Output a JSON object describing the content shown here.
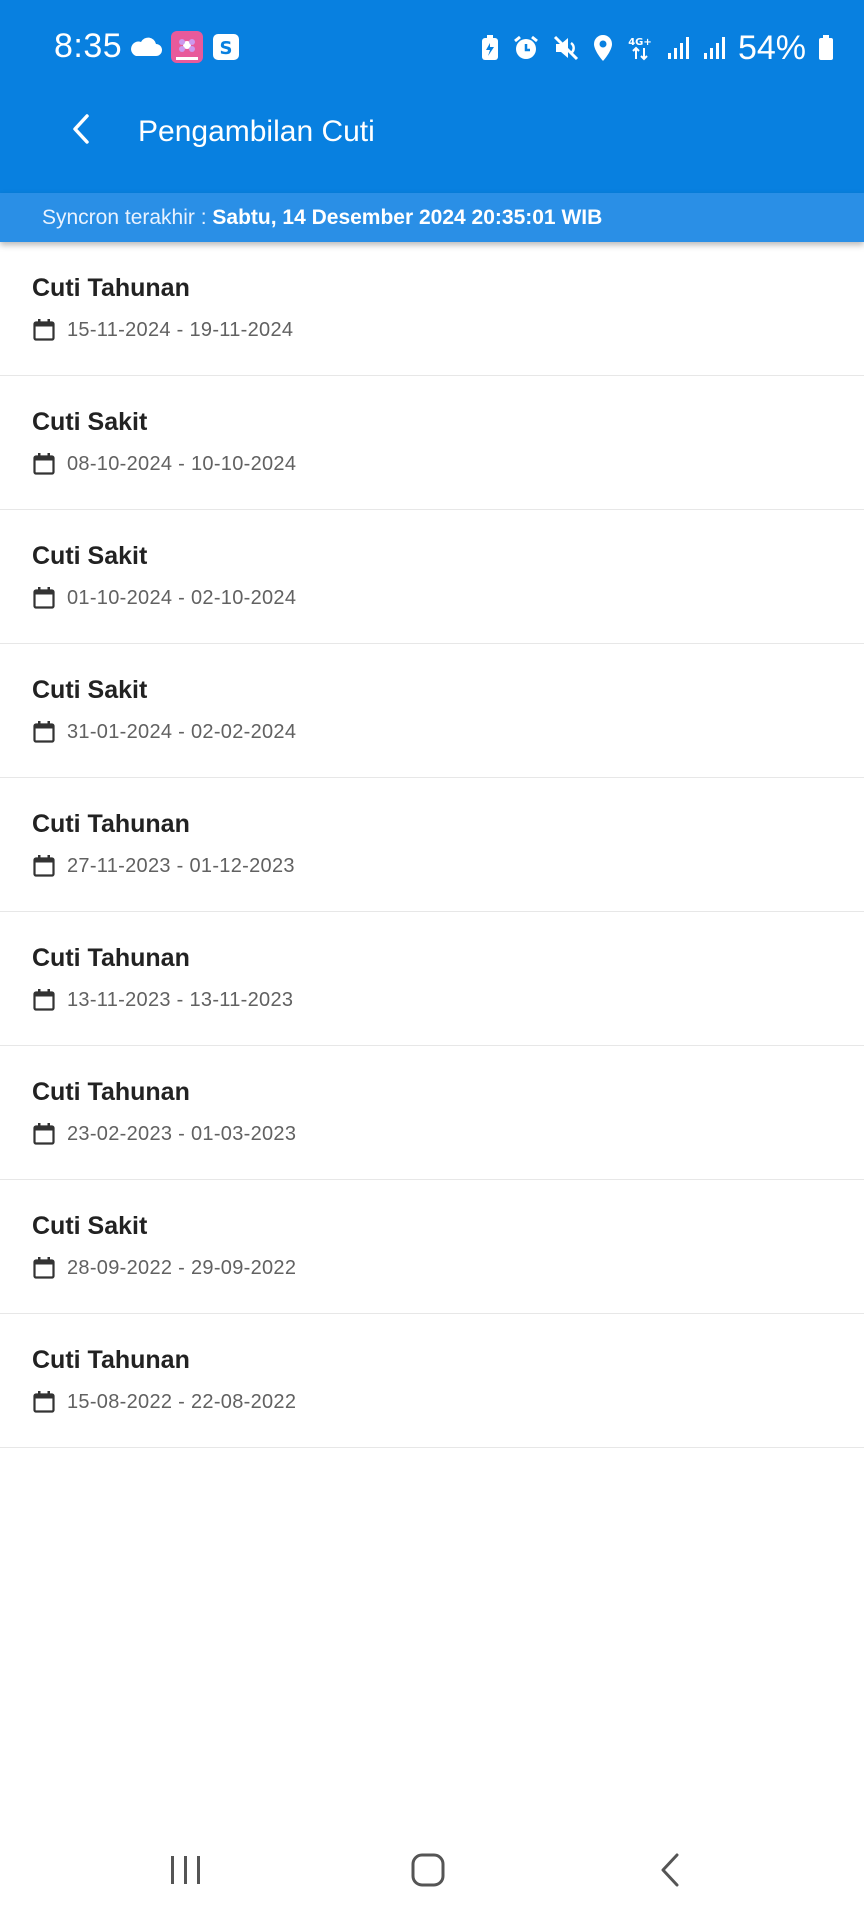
{
  "status_bar": {
    "time": "8:35",
    "battery": "54%",
    "network": "4G+"
  },
  "app_bar": {
    "title": "Pengambilan Cuti"
  },
  "sync": {
    "label": "Syncron terakhir : ",
    "value": "Sabtu, 14 Desember 2024 20:35:01 WIB"
  },
  "leaves": [
    {
      "type": "Cuti Tahunan",
      "dates": "15-11-2024 - 19-11-2024"
    },
    {
      "type": "Cuti Sakit",
      "dates": "08-10-2024 - 10-10-2024"
    },
    {
      "type": "Cuti Sakit",
      "dates": "01-10-2024 - 02-10-2024"
    },
    {
      "type": "Cuti Sakit",
      "dates": "31-01-2024 - 02-02-2024"
    },
    {
      "type": "Cuti Tahunan",
      "dates": "27-11-2023 - 01-12-2023"
    },
    {
      "type": "Cuti Tahunan",
      "dates": "13-11-2023 - 13-11-2023"
    },
    {
      "type": "Cuti Tahunan",
      "dates": "23-02-2023 - 01-03-2023"
    },
    {
      "type": "Cuti Sakit",
      "dates": "28-09-2022 - 29-09-2022"
    },
    {
      "type": "Cuti Tahunan",
      "dates": "15-08-2022 - 22-08-2022"
    }
  ],
  "colors": {
    "app_bar": "#0880e0",
    "sync_bar": "#2a8fe6",
    "title_text": "#222222",
    "date_text": "#616161"
  },
  "icons": {
    "back": "chevron-left-icon",
    "date": "calendar-icon"
  }
}
